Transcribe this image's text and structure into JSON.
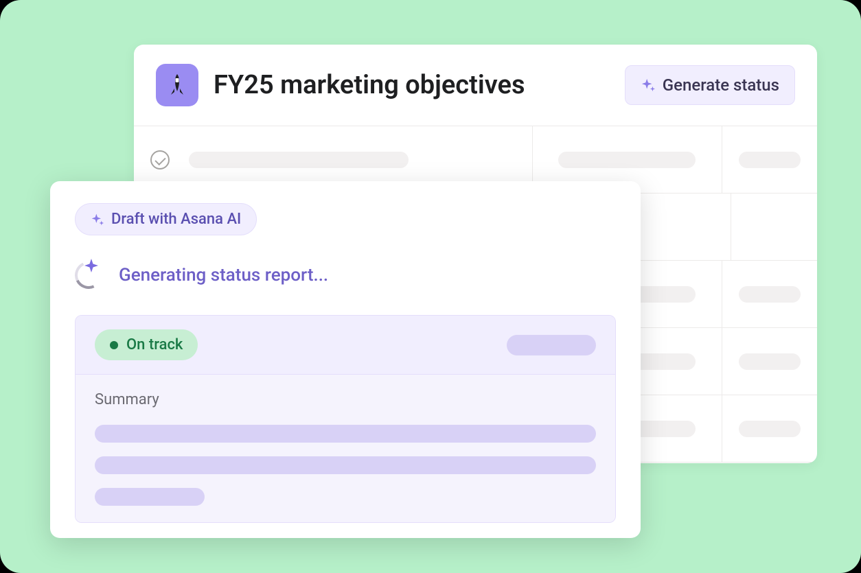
{
  "project": {
    "title": "FY25 marketing objectives",
    "generate_button_label": "Generate status"
  },
  "modal": {
    "draft_pill_label": "Draft with Asana AI",
    "generating_text": "Generating status report...",
    "status_label": "On track",
    "summary_label": "Summary"
  },
  "colors": {
    "accent_purple": "#9a8cf2",
    "stage_green": "#b6f0c9",
    "on_track_green": "#1a7a46"
  }
}
